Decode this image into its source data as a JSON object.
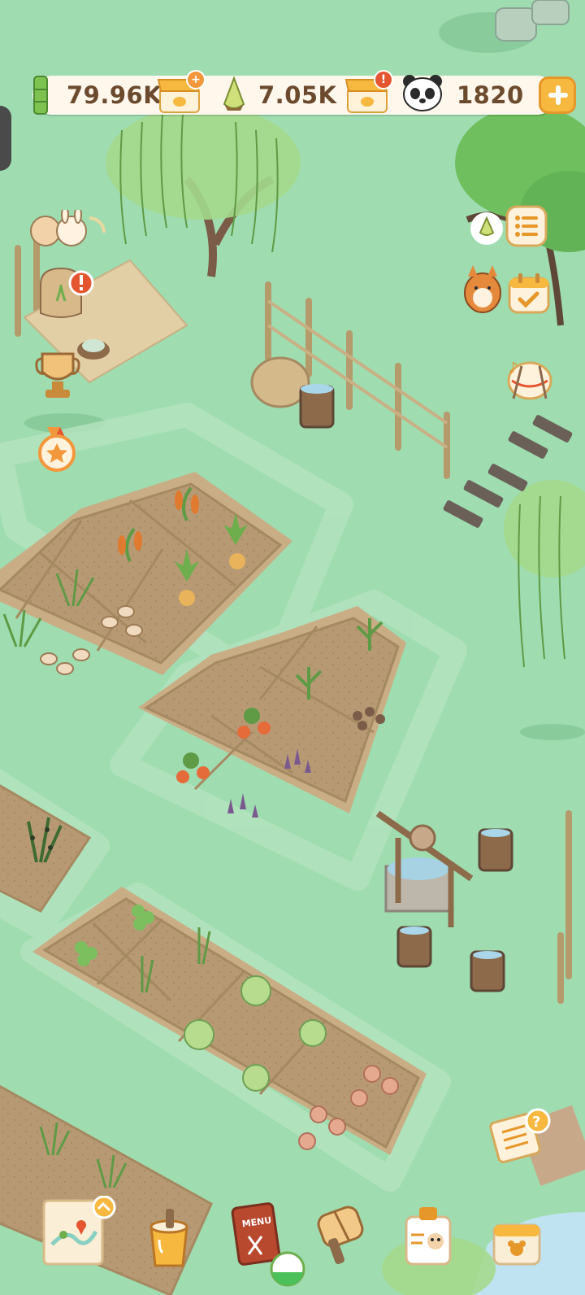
{
  "currencies": {
    "bamboo": {
      "value": "79.96K",
      "icon": "bamboo-icon"
    },
    "bamboo_shoot": {
      "value": "7.05K",
      "icon": "bamboo-shoot-icon"
    },
    "panda": {
      "value": "1820",
      "icon": "panda-icon"
    }
  },
  "shops": {
    "shop_1_badge": "+",
    "shop_2_badge": "!"
  },
  "bottom_menu": {
    "menu_label": "MENU"
  },
  "colors": {
    "ground": "#9fdcb0",
    "soil": "#b99a72",
    "accent": "#f6b83f",
    "text": "#6b4a2d"
  }
}
